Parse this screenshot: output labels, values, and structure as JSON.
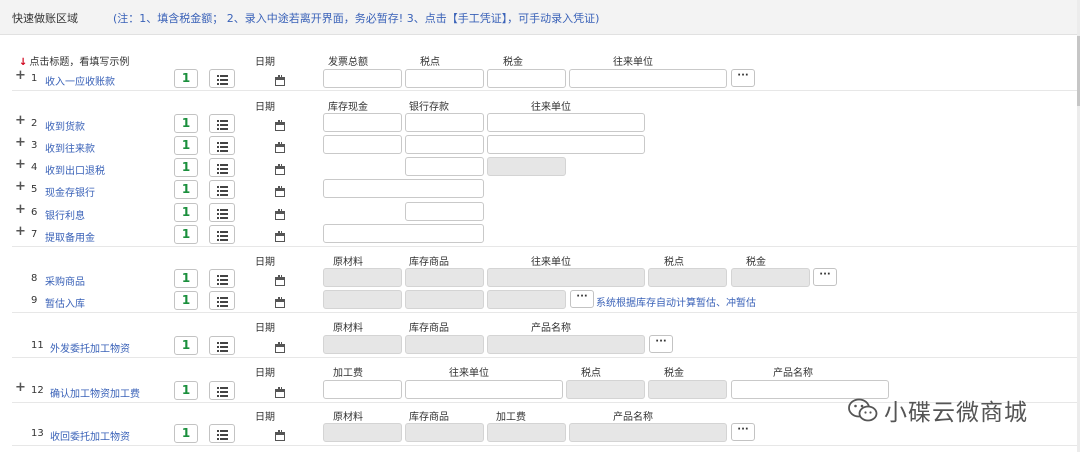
{
  "header": {
    "title": "快速做账区域",
    "notice": "(注：1、填含税金额； 2、录入中途若离开界面，务必暂存! 3、点击【手工凭证】，可手动录入凭证)"
  },
  "hint": "点击标题，看填写示例",
  "headers": {
    "h1": {
      "date": "日期",
      "c1": "发票总额",
      "c2": "税点",
      "c3": "税金",
      "c4": "往来单位"
    },
    "h2": {
      "date": "日期",
      "c1": "库存现金",
      "c2": "银行存款",
      "c3": "往来单位"
    },
    "h3": {
      "date": "日期",
      "c1": "原材料",
      "c2": "库存商品",
      "c3": "往来单位",
      "c4": "税点",
      "c5": "税金"
    },
    "h4": {
      "date": "日期",
      "c1": "原材料",
      "c2": "库存商品",
      "c3": "产品名称"
    },
    "h5": {
      "date": "日期",
      "c1": "加工费",
      "c2": "往来单位",
      "c3": "税点",
      "c4": "税金",
      "c5": "产品名称"
    },
    "h6": {
      "date": "日期",
      "c1": "原材料",
      "c2": "库存商品",
      "c3": "加工费",
      "c4": "产品名称"
    }
  },
  "rows": [
    {
      "num": "1",
      "label": "收入一应收账款",
      "count": "1"
    },
    {
      "num": "2",
      "label": "收到货款",
      "count": "1"
    },
    {
      "num": "3",
      "label": "收到往来款",
      "count": "1"
    },
    {
      "num": "4",
      "label": "收到出口退税",
      "count": "1"
    },
    {
      "num": "5",
      "label": "现金存银行",
      "count": "1"
    },
    {
      "num": "6",
      "label": "银行利息",
      "count": "1"
    },
    {
      "num": "7",
      "label": "提取备用金",
      "count": "1"
    },
    {
      "num": "8",
      "label": "采购商品",
      "count": "1"
    },
    {
      "num": "9",
      "label": "暂估入库",
      "count": "1"
    },
    {
      "num": "11",
      "label": "外发委托加工物资",
      "count": "1"
    },
    {
      "num": "12",
      "label": "确认加工物资加工费",
      "count": "1"
    },
    {
      "num": "13",
      "label": "收回委托加工物资",
      "count": "1"
    }
  ],
  "row9_note": "系统根据库存自动计算暂估、冲暂估",
  "more_label": "···",
  "watermark": "小碟云微商城"
}
